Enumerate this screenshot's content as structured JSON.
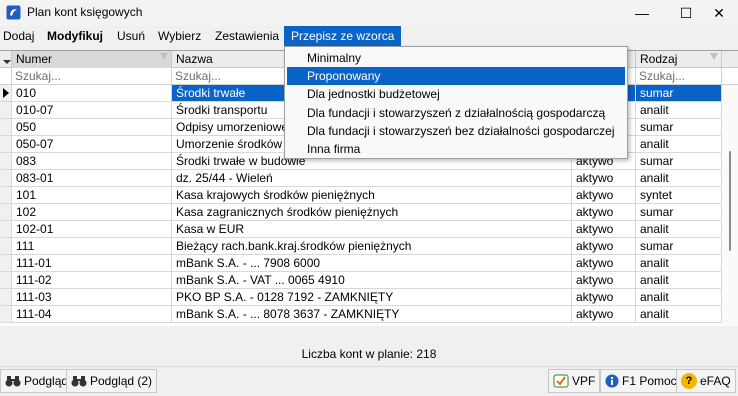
{
  "window": {
    "title": "Plan kont księgowych",
    "minimize_glyph": "—",
    "maximize_glyph": "☐",
    "close_glyph": "✕"
  },
  "menu": {
    "items": [
      "Dodaj",
      "Modyfikuj",
      "Usuń",
      "Wybierz",
      "Zestawienia",
      "Przepisz ze wzorca"
    ]
  },
  "grid": {
    "columns": [
      "Numer",
      "Nazwa",
      "",
      "Rodzaj"
    ],
    "filter_placeholder": "Szukaj...",
    "rows": [
      {
        "numer": "010",
        "nazwa": "Środki trwałe",
        "typ": "",
        "rodzaj": "sumar"
      },
      {
        "numer": "010-07",
        "nazwa": "Środki transportu",
        "typ": "",
        "rodzaj": "analit"
      },
      {
        "numer": "050",
        "nazwa": "Odpisy umorzeniowe",
        "typ": "",
        "rodzaj": "sumar"
      },
      {
        "numer": "050-07",
        "nazwa": "Umorzenie środków t",
        "typ": "",
        "rodzaj": "analit"
      },
      {
        "numer": "083",
        "nazwa": "Środki trwałe w budowie",
        "typ": "aktywo",
        "rodzaj": "sumar"
      },
      {
        "numer": "083-01",
        "nazwa": "dz. 25/44 - Wieleń",
        "typ": "aktywo",
        "rodzaj": "analit"
      },
      {
        "numer": "101",
        "nazwa": "Kasa krajowych środków pieniężnych",
        "typ": "aktywo",
        "rodzaj": "syntet"
      },
      {
        "numer": "102",
        "nazwa": "Kasa zagranicznych środków pieniężnych",
        "typ": "aktywo",
        "rodzaj": "sumar"
      },
      {
        "numer": "102-01",
        "nazwa": "Kasa w EUR",
        "typ": "aktywo",
        "rodzaj": "analit"
      },
      {
        "numer": "111",
        "nazwa": "Bieżący rach.bank.kraj.środków pieniężnych",
        "typ": "aktywo",
        "rodzaj": "sumar"
      },
      {
        "numer": "111-01",
        "nazwa": "mBank S.A. - ... 7908 6000",
        "typ": "aktywo",
        "rodzaj": "analit"
      },
      {
        "numer": "111-02",
        "nazwa": "mBank S.A. - VAT ... 0065 4910",
        "typ": "aktywo",
        "rodzaj": "analit"
      },
      {
        "numer": "111-03",
        "nazwa": "PKO BP S.A. - 0128 7192 - ZAMKNIĘTY",
        "typ": "aktywo",
        "rodzaj": "analit"
      },
      {
        "numer": "111-04",
        "nazwa": "mBank S.A. - ... 8078 3637 - ZAMKNIĘTY",
        "typ": "aktywo",
        "rodzaj": "analit"
      }
    ]
  },
  "dropdown": {
    "items": [
      "Minimalny",
      "Proponowany",
      "Dla jednostki budżetowej",
      "Dla fundacji i stowarzyszeń z działalnością gospodarczą",
      "Dla fundacji i stowarzyszeń bez działalności gospodarczej",
      "Inna firma"
    ],
    "highlighted": "Proponowany"
  },
  "status": {
    "text": "Liczba kont w planie: 218"
  },
  "bottom": {
    "preview_label": "Podgląd",
    "preview2_label": "Podgląd (2)",
    "vpf_label": "VPF",
    "help_label": "F1 Pomoc",
    "efaq_label": "eFAQ",
    "help_icon_glyph": "?"
  },
  "colors": {
    "accent": "#0a64c8",
    "selected_text": "#ffffff"
  }
}
